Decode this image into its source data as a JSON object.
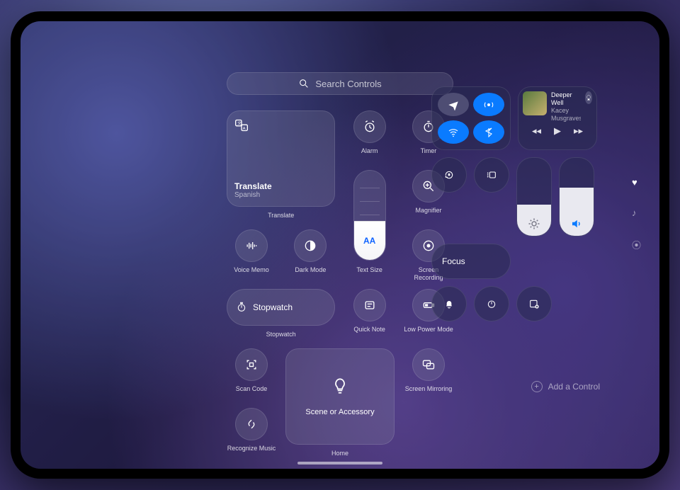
{
  "search": {
    "placeholder": "Search Controls"
  },
  "gallery": {
    "translate": {
      "title": "Translate",
      "subtitle": "Spanish",
      "label": "Translate"
    },
    "alarm": {
      "label": "Alarm"
    },
    "timer": {
      "label": "Timer"
    },
    "magnifier": {
      "label": "Magnifier"
    },
    "voice_memo": {
      "label": "Voice Memo"
    },
    "dark_mode": {
      "label": "Dark Mode"
    },
    "text_size": {
      "label": "Text Size",
      "glyph": "AA"
    },
    "screen_rec": {
      "label": "Screen Recording"
    },
    "stopwatch": {
      "title": "Stopwatch",
      "label": "Stopwatch"
    },
    "quick_note": {
      "label": "Quick Note"
    },
    "low_power": {
      "label": "Low Power Mode"
    },
    "scan_code": {
      "label": "Scan Code"
    },
    "home": {
      "title": "Scene or Accessory",
      "label": "Home"
    },
    "screen_mirr": {
      "label": "Screen Mirroring"
    },
    "recognize": {
      "label": "Recognize Music"
    }
  },
  "cc": {
    "focus": {
      "label": "Focus"
    },
    "now_playing": {
      "title": "Deeper Well",
      "artist": "Kacey Musgraves"
    },
    "add_control": "Add a Control"
  },
  "icons": {
    "search": "search",
    "airplane": "airplane",
    "airdrop": "airdrop",
    "wifi": "wifi",
    "bluetooth": "bluetooth",
    "lock_rotation": "lock-rotation",
    "stage_manager": "stage-manager",
    "bell": "bell",
    "timer_small": "timer",
    "note_add": "note-add",
    "airplay": "airplay",
    "rewind": "rewind",
    "play": "play",
    "forward": "forward",
    "sun": "sun",
    "speaker": "speaker",
    "heart": "heart",
    "music_note": "music",
    "airplay_audio": "airplay-audio"
  }
}
